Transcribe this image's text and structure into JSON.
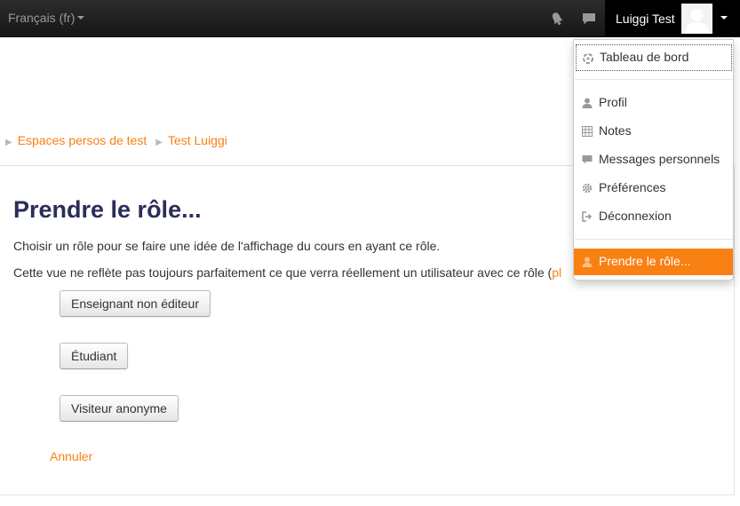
{
  "navbar": {
    "language": "Français (fr)",
    "user_name": "Luiggi Test"
  },
  "breadcrumb": [
    {
      "label": "Espaces persos de test"
    },
    {
      "label": "Test Luiggi"
    }
  ],
  "main": {
    "title": "Prendre le rôle...",
    "intro": "Choisir un rôle pour se faire une idée de l'affichage du cours en ayant ce rôle.",
    "warning": "Cette vue ne reflète pas toujours parfaitement ce que verra réellement un utilisateur avec ce rôle (",
    "warning_link": "pl",
    "roles": [
      {
        "label": "Enseignant non éditeur"
      },
      {
        "label": "Étudiant"
      },
      {
        "label": "Visiteur anonyme"
      }
    ],
    "cancel": "Annuler"
  },
  "user_menu": {
    "items": [
      {
        "label": "Tableau de bord",
        "icon": "dashboard-icon"
      },
      {
        "label": "Profil",
        "icon": "user-icon"
      },
      {
        "label": "Notes",
        "icon": "grades-table-icon"
      },
      {
        "label": "Messages personnels",
        "icon": "message-icon"
      },
      {
        "label": "Préférences",
        "icon": "gear-icon"
      },
      {
        "label": "Déconnexion",
        "icon": "logout-icon"
      },
      {
        "label": "Prendre le rôle...",
        "icon": "user-icon"
      }
    ]
  },
  "colors": {
    "accent": "#f98012",
    "title": "#2b2d5a",
    "navbar": "#1f1f1f"
  }
}
